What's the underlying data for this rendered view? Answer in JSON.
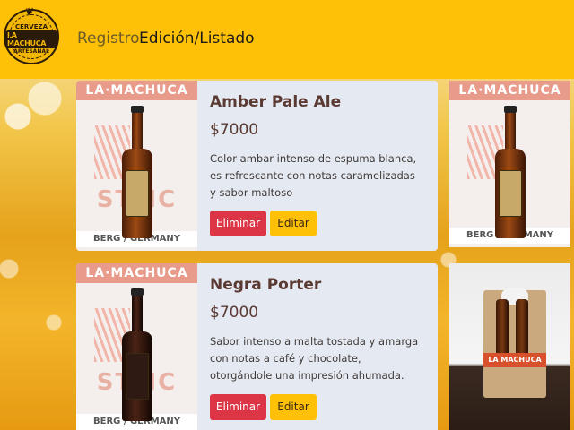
{
  "navbar": {
    "logo": {
      "top": "CERVEZA",
      "main": "LA MACHUCA",
      "bottom": "ARTESANAL"
    },
    "links": [
      {
        "label": "Registro",
        "active": false
      },
      {
        "label": "Edición/Listado",
        "active": true
      }
    ]
  },
  "products": [
    {
      "name": "Amber Pale Ale",
      "price": "$7000",
      "description": "Color ambar intenso de espuma blanca, es refrescante con notas caramelizadas y sabor maltoso",
      "delete_label": "Eliminar",
      "edit_label": "Editar",
      "photo_banner": "LA·MACHUCA",
      "photo_text": "STMC",
      "photo_foot": "BERG / GERMANY"
    },
    {
      "name": "Negra Porter",
      "price": "$7000",
      "description": "Sabor intenso a malta tostada y amarga con notas a café y chocolate, otorgándole una impresión ahumada.",
      "delete_label": "Eliminar",
      "edit_label": "Editar",
      "photo_banner": "LA·MACHUCA",
      "photo_text": "STMC",
      "photo_foot": "BERG / GERMANY"
    }
  ],
  "side_photos": [
    {
      "banner": "LA·MACHUCA",
      "foot": "BERG / GERMANY"
    },
    {
      "pack_label": "LA MACHUCA"
    }
  ],
  "colors": {
    "navbar": "#ffc107",
    "card": "#e5e9f1",
    "danger": "#dc3545",
    "warning": "#ffc107"
  }
}
